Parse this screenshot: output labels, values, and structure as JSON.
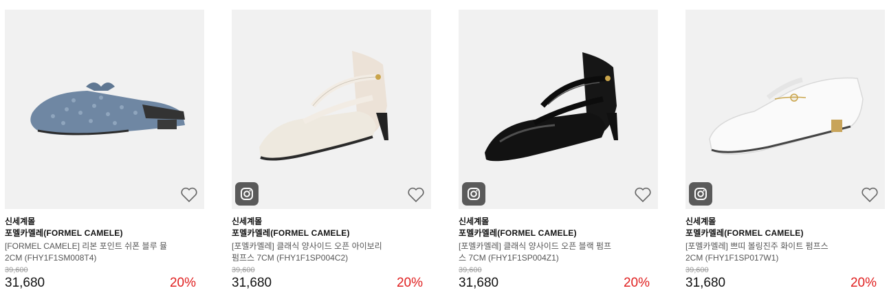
{
  "products": [
    {
      "seller": "신세계몰",
      "brand": "포멜카멜레(FORMEL CAMELE)",
      "name_line1": "[FORMEL CAMELE] 리본 포인트 쉬폰 블루 뮬",
      "name_line2": "2CM (FHY1F1SM008T4)",
      "original_price": "39,600",
      "price": "31,680",
      "discount": "20%",
      "shoe_color": "#6f87a3",
      "has_instagram": false
    },
    {
      "seller": "신세계몰",
      "brand": "포멜카멜레(FORMEL CAMELE)",
      "name_line1": "[포멜카멜레] 클래식 양사이드 오픈 아이보리",
      "name_line2": "펌프스 7CM (FHY1F1SP004C2)",
      "original_price": "39,600",
      "price": "31,680",
      "discount": "20%",
      "shoe_color": "#eee9df",
      "has_instagram": true
    },
    {
      "seller": "신세계몰",
      "brand": "포멜카멜레(FORMEL CAMELE)",
      "name_line1": "[포멜카멜레] 클래식 양사이드 오픈 블랙 펌프",
      "name_line2": "스 7CM (FHY1F1SP004Z1)",
      "original_price": "39,600",
      "price": "31,680",
      "discount": "20%",
      "shoe_color": "#121212",
      "has_instagram": true
    },
    {
      "seller": "신세계몰",
      "brand": "포멜카멜레(FORMEL CAMELE)",
      "name_line1": "[포멜카멜레] 쁘띠 볼링진주 화이트 펌프스",
      "name_line2": "2CM (FHY1F1SP017W1)",
      "original_price": "39,600",
      "price": "31,680",
      "discount": "20%",
      "shoe_color": "#fafafa",
      "has_instagram": true
    }
  ],
  "icons": {
    "wishlist": "heart-outline-icon",
    "social": "instagram-icon"
  }
}
